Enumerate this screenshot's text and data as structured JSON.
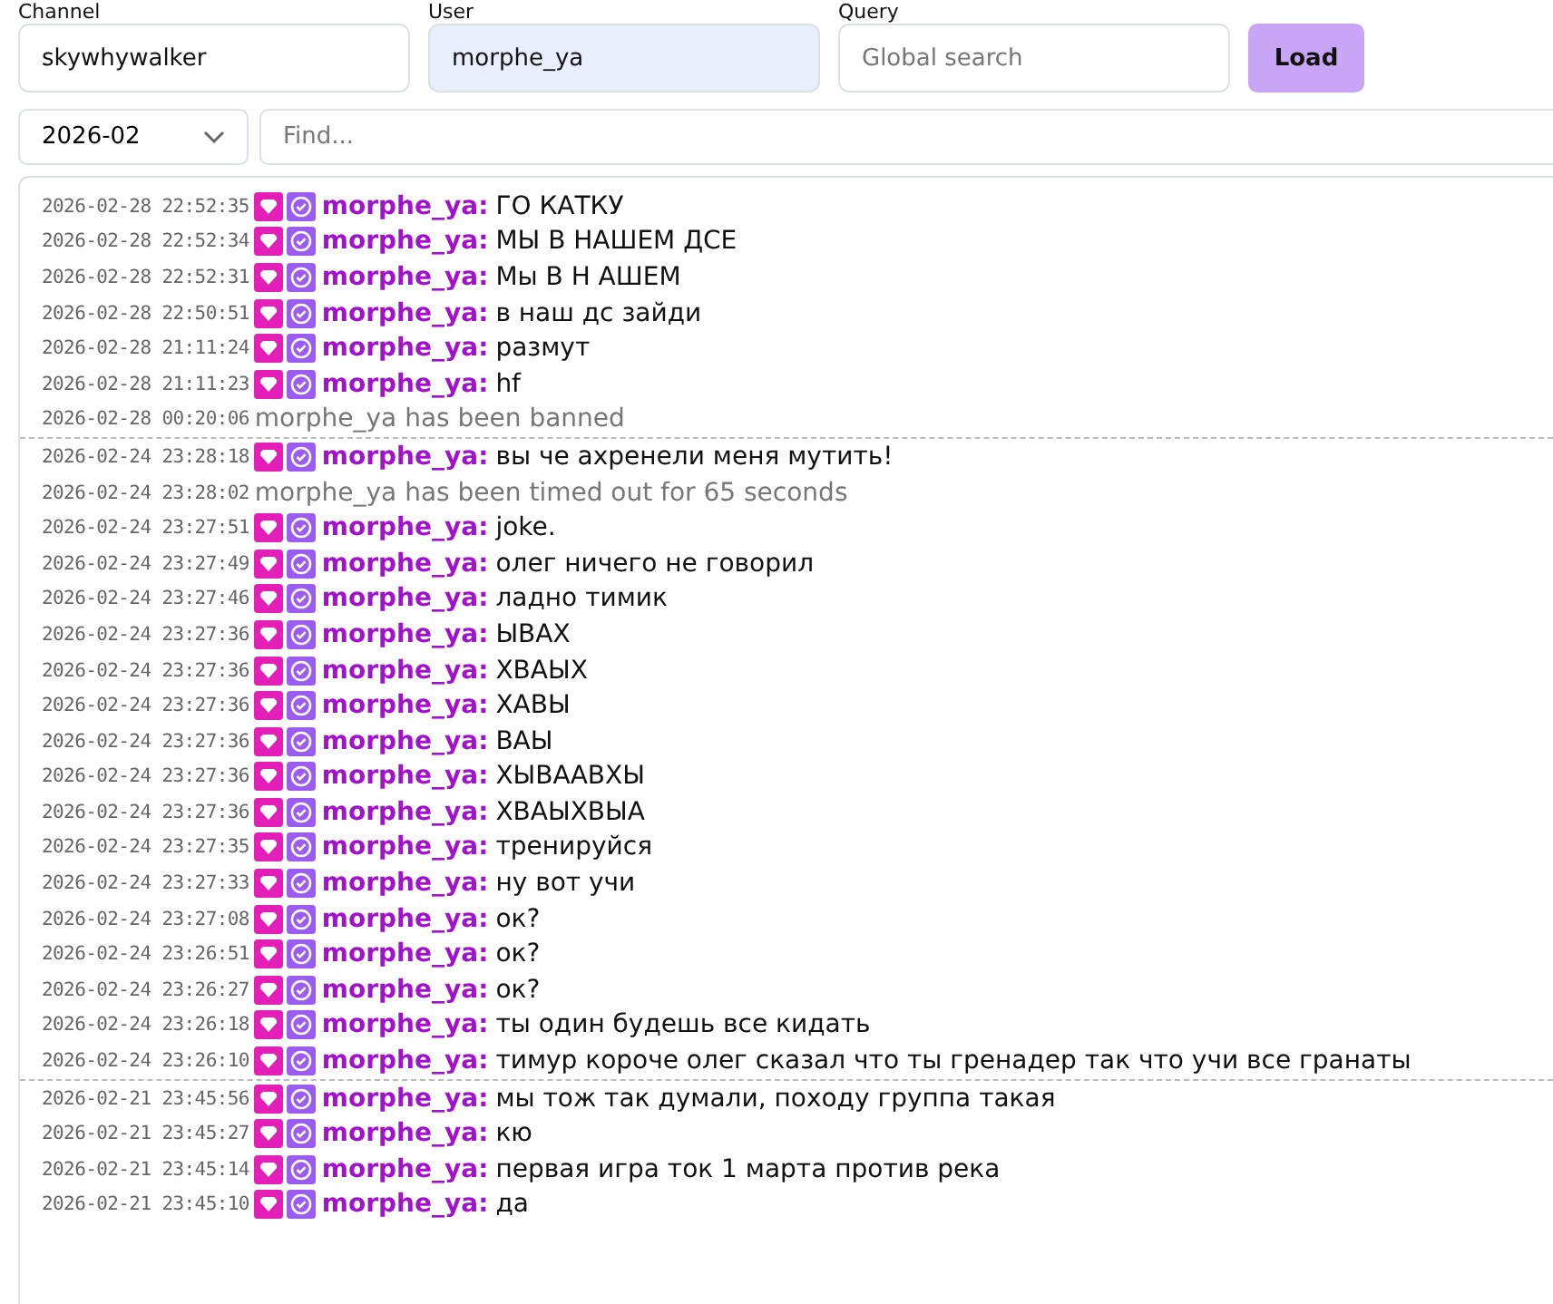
{
  "filters": [
    {
      "label": "Channel",
      "value": "skywhywalker",
      "highlighted": false
    },
    {
      "label": "User",
      "value": "morphe_ya",
      "highlighted": true
    },
    {
      "label": "Query",
      "placeholder": "Global search",
      "highlighted": false
    }
  ],
  "load_button": "Load",
  "month_select": "2026-02",
  "find": {
    "placeholder": "Find..."
  },
  "days": [
    {
      "messages": [
        {
          "kind": "message",
          "time": "2026-02-28 22:52:35",
          "user": "morphe_ya:",
          "text": "ГО КАТКУ"
        },
        {
          "kind": "message",
          "time": "2026-02-28 22:52:34",
          "user": "morphe_ya:",
          "text": "МЫ В НАШЕМ ДСЕ"
        },
        {
          "kind": "message",
          "time": "2026-02-28 22:52:31",
          "user": "morphe_ya:",
          "text": "Мы В Н АШЕМ"
        },
        {
          "kind": "message",
          "time": "2026-02-28 22:50:51",
          "user": "morphe_ya:",
          "text": "в наш дс зайди"
        },
        {
          "kind": "message",
          "time": "2026-02-28 21:11:24",
          "user": "morphe_ya:",
          "text": "размут"
        },
        {
          "kind": "message",
          "time": "2026-02-28 21:11:23",
          "user": "morphe_ya:",
          "text": "hf"
        },
        {
          "kind": "system",
          "time": "2026-02-28 00:20:06",
          "text": "morphe_ya has been banned"
        }
      ]
    },
    {
      "messages": [
        {
          "kind": "message",
          "time": "2026-02-24 23:28:18",
          "user": "morphe_ya:",
          "text": "вы че ахренели меня мутить!"
        },
        {
          "kind": "system",
          "time": "2026-02-24 23:28:02",
          "text": "morphe_ya has been timed out for 65 seconds"
        },
        {
          "kind": "message",
          "time": "2026-02-24 23:27:51",
          "user": "morphe_ya:",
          "text": "joke."
        },
        {
          "kind": "message",
          "time": "2026-02-24 23:27:49",
          "user": "morphe_ya:",
          "text": "олег ничего не говорил"
        },
        {
          "kind": "message",
          "time": "2026-02-24 23:27:46",
          "user": "morphe_ya:",
          "text": "ладно тимик"
        },
        {
          "kind": "message",
          "time": "2026-02-24 23:27:36",
          "user": "morphe_ya:",
          "text": "ЫВАХ"
        },
        {
          "kind": "message",
          "time": "2026-02-24 23:27:36",
          "user": "morphe_ya:",
          "text": "ХВАЫХ"
        },
        {
          "kind": "message",
          "time": "2026-02-24 23:27:36",
          "user": "morphe_ya:",
          "text": "ХАВЫ"
        },
        {
          "kind": "message",
          "time": "2026-02-24 23:27:36",
          "user": "morphe_ya:",
          "text": "ВАЫ"
        },
        {
          "kind": "message",
          "time": "2026-02-24 23:27:36",
          "user": "morphe_ya:",
          "text": "ХЫВААВХЫ"
        },
        {
          "kind": "message",
          "time": "2026-02-24 23:27:36",
          "user": "morphe_ya:",
          "text": "ХВАЫХВЫА"
        },
        {
          "kind": "message",
          "time": "2026-02-24 23:27:35",
          "user": "morphe_ya:",
          "text": "тренируйся"
        },
        {
          "kind": "message",
          "time": "2026-02-24 23:27:33",
          "user": "morphe_ya:",
          "text": "ну вот учи"
        },
        {
          "kind": "message",
          "time": "2026-02-24 23:27:08",
          "user": "morphe_ya:",
          "text": "ок?"
        },
        {
          "kind": "message",
          "time": "2026-02-24 23:26:51",
          "user": "morphe_ya:",
          "text": "ок?"
        },
        {
          "kind": "message",
          "time": "2026-02-24 23:26:27",
          "user": "morphe_ya:",
          "text": "ок?"
        },
        {
          "kind": "message",
          "time": "2026-02-24 23:26:18",
          "user": "morphe_ya:",
          "text": "ты один будешь все кидать"
        },
        {
          "kind": "message",
          "time": "2026-02-24 23:26:10",
          "user": "morphe_ya:",
          "text": "тимур короче олег сказал что ты гренадер так что учи все гранаты"
        }
      ]
    },
    {
      "messages": [
        {
          "kind": "message",
          "time": "2026-02-21 23:45:56",
          "user": "morphe_ya:",
          "text": "мы тож так думали, походу группа такая"
        },
        {
          "kind": "message",
          "time": "2026-02-21 23:45:27",
          "user": "morphe_ya:",
          "text": "кю"
        },
        {
          "kind": "message",
          "time": "2026-02-21 23:45:14",
          "user": "morphe_ya:",
          "text": "первая игра ток 1 марта против река"
        },
        {
          "kind": "message",
          "time": "2026-02-21 23:45:10",
          "user": "morphe_ya:",
          "text": "да"
        }
      ]
    }
  ]
}
